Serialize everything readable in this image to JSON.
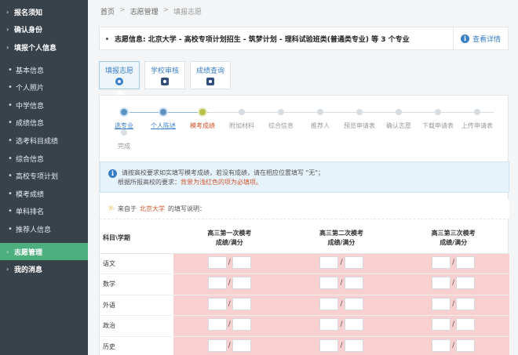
{
  "sidebar": {
    "top_items": [
      {
        "label": "报名须知"
      },
      {
        "label": "确认身份"
      },
      {
        "label": "填报个人信息"
      }
    ],
    "sub_items": [
      {
        "label": "基本信息"
      },
      {
        "label": "个人照片"
      },
      {
        "label": "中学信息"
      },
      {
        "label": "成绩信息"
      },
      {
        "label": "选考科目成绩"
      },
      {
        "label": "综合信息"
      },
      {
        "label": "高校专项计划"
      },
      {
        "label": "模考成绩"
      },
      {
        "label": "单科排名"
      },
      {
        "label": "推荐人信息"
      }
    ],
    "bottom_items": [
      {
        "label": "志愿管理",
        "active": true
      },
      {
        "label": "我的消息"
      }
    ]
  },
  "breadcrumb": {
    "home": "首页",
    "section": "志愿管理",
    "current": "填报志愿",
    "sep": ">"
  },
  "info_bar": {
    "text": "志愿信息:  北京大学 - 高校专项计划招生 - 筑梦计划 - 理科试验班类(普通类专业) 等 3 个专业",
    "details_label": "查看详情"
  },
  "tabs": [
    {
      "label": "填报志愿",
      "active": true,
      "icon": "plus-circle-icon"
    },
    {
      "label": "学校审核",
      "active": false,
      "icon": "check-square-icon"
    },
    {
      "label": "成绩查询",
      "active": false,
      "icon": "search-square-icon"
    }
  ],
  "steps": [
    {
      "label": "选专业",
      "state": "done"
    },
    {
      "label": "个人陈述",
      "state": "done"
    },
    {
      "label": "模考成绩",
      "state": "current"
    },
    {
      "label": "附加材料",
      "state": "todo"
    },
    {
      "label": "综合信息",
      "state": "todo"
    },
    {
      "label": "推荐人",
      "state": "todo"
    },
    {
      "label": "预览申请表",
      "state": "todo"
    },
    {
      "label": "确认志愿",
      "state": "todo"
    },
    {
      "label": "下载申请表",
      "state": "todo"
    },
    {
      "label": "上传申请表",
      "state": "todo"
    },
    {
      "label": "完成",
      "state": "todo"
    }
  ],
  "notice": {
    "line1": "请按高校要求如实填写模考成绩，若没有成绩，请在相应位置填写 \"无\"；",
    "line2_prefix": "根据所报高校的要求：",
    "line2_highlight": "背景为浅红色的项为必填项。"
  },
  "source": {
    "prefix": "来自于",
    "university": "北京大学",
    "suffix": "的填写说明："
  },
  "score_table": {
    "subject_header": "科目\\学期",
    "columns": [
      {
        "line1": "高三第一次模考",
        "line2": "成绩/满分"
      },
      {
        "line1": "高三第二次模考",
        "line2": "成绩/满分"
      },
      {
        "line1": "高三第三次模考",
        "line2": "成绩/满分"
      }
    ],
    "subjects": [
      "语文",
      "数学",
      "外语",
      "政治",
      "历史"
    ],
    "separator": "/"
  },
  "colors": {
    "sidebar_bg": "#37424b",
    "active_green": "#4caf7d",
    "link_blue": "#3a7fc4",
    "required_bg": "#f9d0d0",
    "current_orange": "#d0552a"
  }
}
